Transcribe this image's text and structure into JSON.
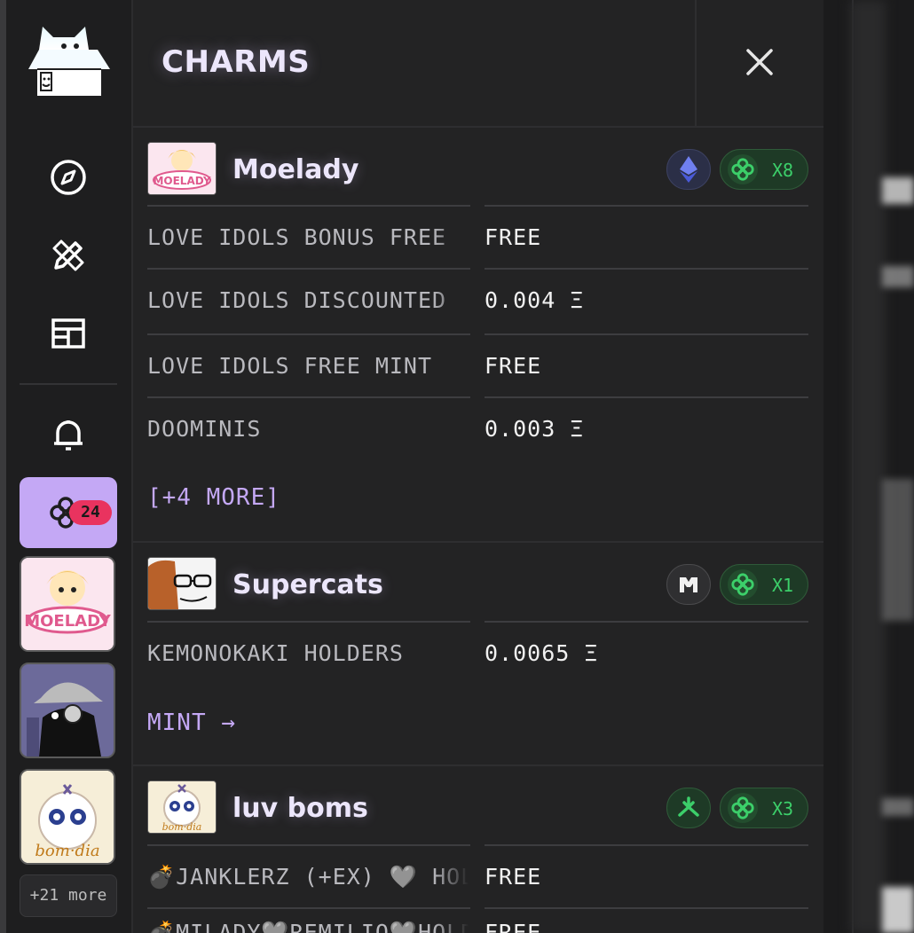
{
  "sidebar": {
    "charm_count": "24",
    "more_label": "+21 more",
    "nav_icons": [
      "compass-icon",
      "pencil-ruler-icon",
      "newspaper-icon",
      "bell-icon"
    ]
  },
  "panel": {
    "title": "CHARMS",
    "collections": [
      {
        "name": "Moelady",
        "chain_icon": "ethereum-icon",
        "multiplier": "X8",
        "rows": [
          {
            "name": "LOVE IDOLS BONUS FREE",
            "price": "FREE"
          },
          {
            "name": "LOVE IDOLS DISCOUNTED",
            "price": "0.004 Ξ"
          },
          {
            "name": "LOVE IDOLS FREE MINT",
            "price": "FREE"
          },
          {
            "name": "DOOMINIS",
            "price": "0.003 Ξ"
          }
        ],
        "link": "[+4 MORE]"
      },
      {
        "name": "Supercats",
        "chain_icon": "magic-eden-icon",
        "multiplier": "X1",
        "rows": [
          {
            "name": "KEMONOKAKI HOLDERS",
            "price": "0.0065 Ξ"
          }
        ],
        "link": "MINT →"
      },
      {
        "name": "luv boms",
        "chain_icon": "abstract-chain-icon",
        "multiplier": "X3",
        "rows": [
          {
            "name": "💣JANKLERZ (+EX) 🩶 HOLDERS",
            "price": "FREE"
          },
          {
            "name": "💣MILADY🩶REMILIO🩶HOLDERS",
            "price": "FREE"
          }
        ]
      }
    ]
  },
  "colors": {
    "accent": "#c4a8f5",
    "badge": "#e9335f",
    "multiplier_green": "#3ccf6a",
    "background": "#232324"
  }
}
